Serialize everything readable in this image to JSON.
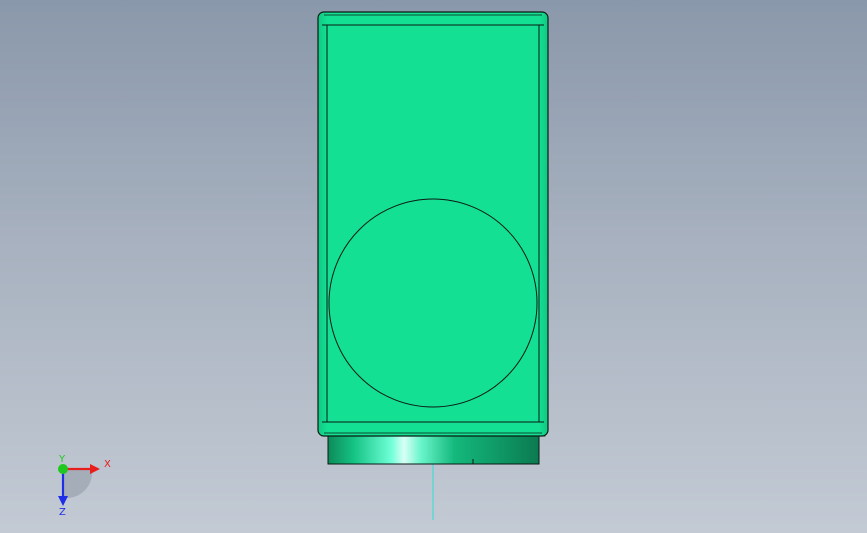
{
  "viewport": {
    "background_top": "#8a98ab",
    "background_bottom": "#c3cad4"
  },
  "model": {
    "body_color": "#14e093",
    "edge_color": "#0a1a12",
    "base_highlight": "#c9fff2"
  },
  "triad": {
    "x_label": "X",
    "y_label": "Y",
    "z_label": "Z",
    "x_color": "#e81e1e",
    "y_color": "#1ec81e",
    "z_color": "#1e2ee8"
  }
}
